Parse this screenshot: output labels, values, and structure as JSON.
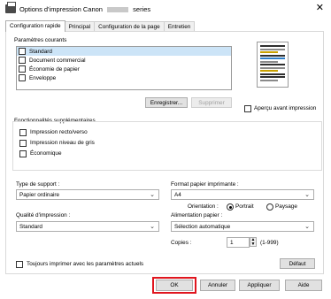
{
  "window": {
    "title_prefix": "Options d'impression Canon",
    "title_suffix": "series",
    "close_glyph": "✕"
  },
  "tabs": [
    {
      "label": "Configuration rapide",
      "active": true
    },
    {
      "label": "Principal",
      "active": false
    },
    {
      "label": "Configuration de la page",
      "active": false
    },
    {
      "label": "Entretien",
      "active": false
    }
  ],
  "current_settings": {
    "label": "Paramètres courants",
    "items": [
      {
        "label": "Standard",
        "icon": "standard-doc-icon",
        "selected": true
      },
      {
        "label": "Document commercial",
        "icon": "business-doc-icon",
        "selected": false
      },
      {
        "label": "Économie de papier",
        "icon": "paper-saving-icon",
        "selected": false
      },
      {
        "label": "Enveloppe",
        "icon": "envelope-icon",
        "selected": false
      }
    ],
    "save_button": "Enregistrer...",
    "delete_button": "Supprimer"
  },
  "preview": {
    "checkbox_label": "Aperçu avant impression",
    "line_colors": [
      "#2f2f2f",
      "#8a8a8a",
      "#c8a000",
      "#2f2f2f",
      "#2f7fc9",
      "#8a8a8a",
      "#2f2f2f",
      "#8a8a8a",
      "#c8a000",
      "#2f2f2f",
      "#2f2f2f",
      "#8a8a8a"
    ]
  },
  "features": {
    "label": "Fonctionnalités supplémentaires",
    "items": [
      {
        "label": "Impression recto/verso"
      },
      {
        "label": "Impression niveau de gris"
      },
      {
        "label": "Économique"
      }
    ]
  },
  "media_type": {
    "label": "Type de support :",
    "value": "Papier ordinaire"
  },
  "print_quality": {
    "label": "Qualité d'impression :",
    "value": "Standard"
  },
  "paper_size": {
    "label": "Format papier imprimante :",
    "value": "A4"
  },
  "orientation": {
    "label": "Orientation :",
    "portrait": "Portrait",
    "landscape": "Paysage",
    "selected": "portrait"
  },
  "paper_source": {
    "label": "Alimentation papier :",
    "value": "Sélection automatique"
  },
  "copies": {
    "label": "Copies :",
    "value": "1",
    "range": "(1-999)"
  },
  "always_print": {
    "label": "Toujours imprimer avec les paramètres actuels"
  },
  "defaults_button": "Défaut",
  "footer": {
    "ok": "OK",
    "cancel": "Annuler",
    "apply": "Appliquer",
    "help": "Aide",
    "highlight_color": "#e0151e"
  }
}
